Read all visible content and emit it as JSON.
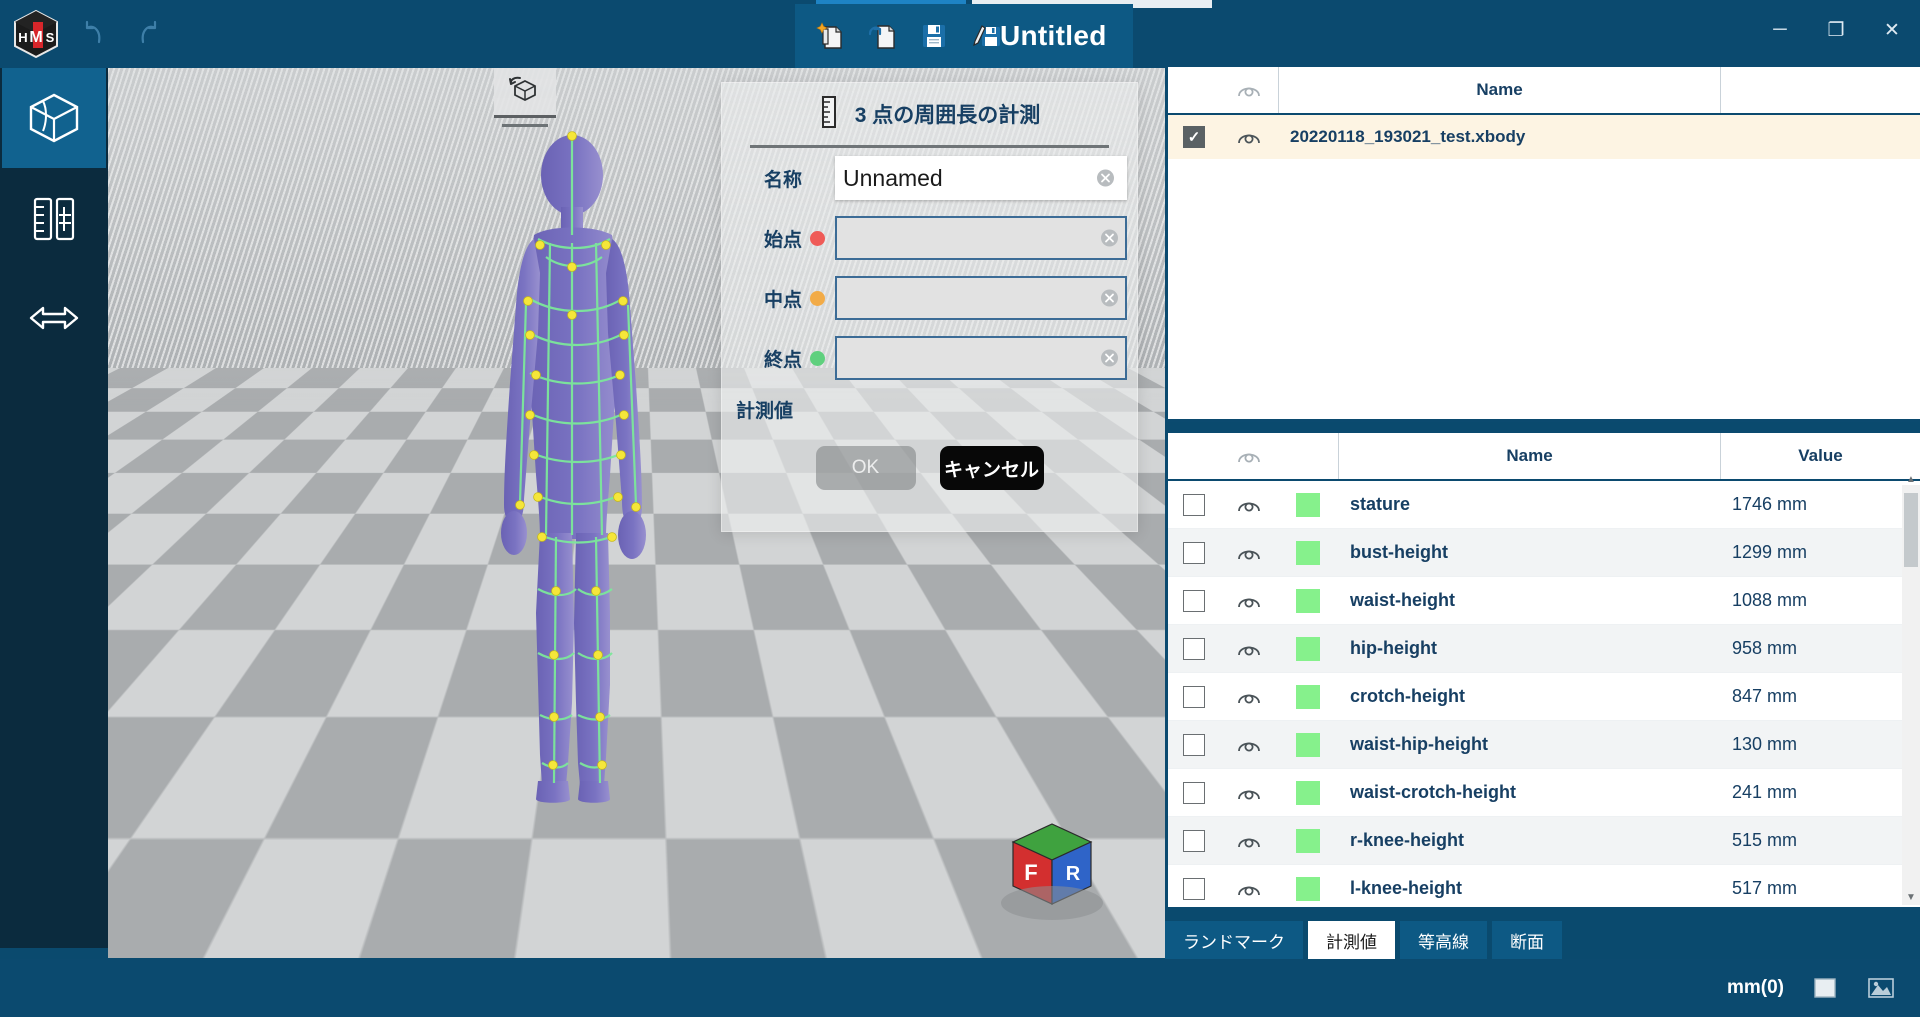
{
  "window": {
    "title": "Untitled",
    "minimize_label": "─",
    "restore_label": "❐",
    "close_label": "✕"
  },
  "titlebar": {
    "logo_icon": "app-logo-icon",
    "undo_icon": "undo-icon",
    "redo_icon": "redo-icon",
    "doc_tools": [
      {
        "name": "new-file",
        "icon": "new-file-icon"
      },
      {
        "name": "open-file",
        "icon": "open-file-icon"
      },
      {
        "name": "save-file",
        "icon": "save-icon"
      },
      {
        "name": "save-as-file",
        "icon": "save-as-icon"
      }
    ]
  },
  "left_rail": {
    "items": [
      {
        "name": "model-view",
        "icon": "cube-icon",
        "active": true
      },
      {
        "name": "measure-tool",
        "icon": "ruler-icon",
        "active": false
      },
      {
        "name": "distance-tool",
        "icon": "double-arrow-icon",
        "active": false
      }
    ]
  },
  "viewport": {
    "rotate_widget_icon": "rotate-view-icon",
    "navcube": {
      "front_label": "F",
      "right_label": "R",
      "front_color": "#d32f2f",
      "right_color": "#2f64c8",
      "top_color": "#3fa23f"
    }
  },
  "dialog": {
    "icon": "ruler-vertical-icon",
    "title": "3 点の周囲長の計測",
    "fields": [
      {
        "label": "名称",
        "name": "name-field",
        "value": "Unnamed",
        "placeholder": "",
        "dot": "none",
        "dot_color": "",
        "clear_icon": "clear-icon",
        "style": "name"
      },
      {
        "label": "始点",
        "name": "start-point-field",
        "value": "",
        "placeholder": "",
        "dot": "red",
        "dot_color": "#ef5b57",
        "clear_icon": "clear-icon",
        "style": "plain"
      },
      {
        "label": "中点",
        "name": "mid-point-field",
        "value": "",
        "placeholder": "",
        "dot": "orange",
        "dot_color": "#f2ab47",
        "clear_icon": "clear-icon",
        "style": "plain"
      },
      {
        "label": "終点",
        "name": "end-point-field",
        "value": "",
        "placeholder": "",
        "dot": "green",
        "dot_color": "#5fd07e",
        "clear_icon": "clear-icon",
        "style": "plain"
      }
    ],
    "calc_label": "計測値",
    "ok_label": "OK",
    "ok_disabled": true,
    "cancel_label": "キャンセル"
  },
  "file_panel": {
    "columns": {
      "eye": "◎",
      "name": "Name",
      "value": ""
    },
    "rows": [
      {
        "checked": true,
        "check_glyph": "✓",
        "eye_icon": "eye-icon",
        "name": "20220118_193021_test.xbody",
        "selected": true
      }
    ]
  },
  "measure_panel": {
    "columns": {
      "eye": "◎",
      "name": "Name",
      "value": "Value"
    },
    "swatch_color": "#86f18c",
    "rows": [
      {
        "checked": false,
        "name": "stature",
        "value": "1746 mm"
      },
      {
        "checked": false,
        "name": "bust-height",
        "value": "1299 mm"
      },
      {
        "checked": false,
        "name": "waist-height",
        "value": "1088 mm"
      },
      {
        "checked": false,
        "name": "hip-height",
        "value": "958 mm"
      },
      {
        "checked": false,
        "name": "crotch-height",
        "value": "847 mm"
      },
      {
        "checked": false,
        "name": "waist-hip-height",
        "value": "130 mm"
      },
      {
        "checked": false,
        "name": "waist-crotch-height",
        "value": "241 mm"
      },
      {
        "checked": false,
        "name": "r-knee-height",
        "value": "515 mm"
      },
      {
        "checked": false,
        "name": "l-knee-height",
        "value": "517 mm"
      }
    ]
  },
  "bottom_tabs": [
    {
      "label": "ランドマーク",
      "name": "tab-landmark",
      "active": false
    },
    {
      "label": "計測値",
      "name": "tab-measurement",
      "active": true
    },
    {
      "label": "等高線",
      "name": "tab-contour",
      "active": false
    },
    {
      "label": "断面",
      "name": "tab-section",
      "active": false
    }
  ],
  "status_bar": {
    "unit": "mm(0)",
    "snapshot_icon": "snapshot-icon",
    "export_icon": "export-image-icon"
  }
}
